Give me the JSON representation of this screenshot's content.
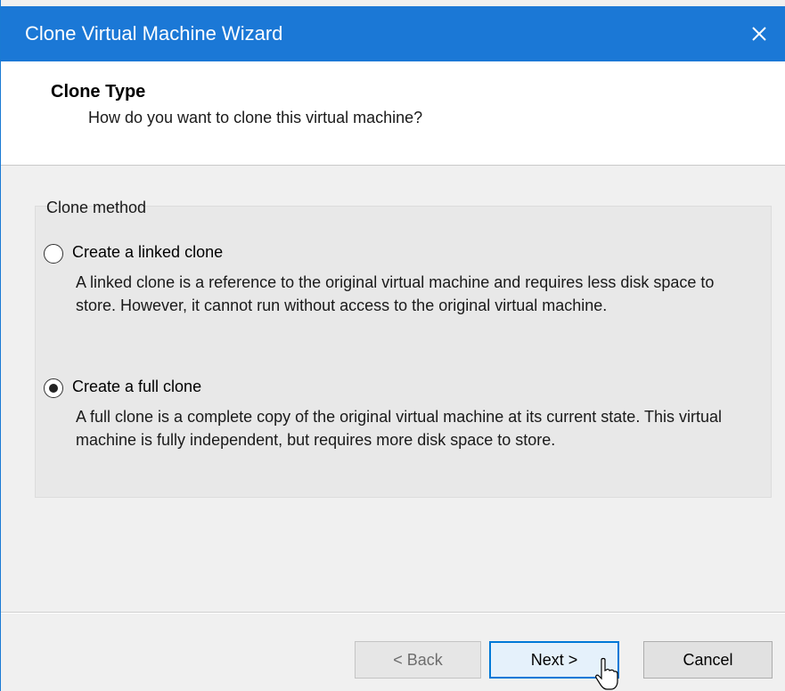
{
  "window": {
    "title": "Clone Virtual Machine Wizard",
    "accent_color": "#1b78d6",
    "close_icon": "close-icon"
  },
  "header": {
    "title": "Clone Type",
    "subtitle": "How do you want to clone this virtual machine?"
  },
  "clone_method": {
    "legend": "Clone method",
    "options": [
      {
        "label": "Create a linked clone",
        "selected": false,
        "description": "A linked clone is a reference to the original virtual machine and requires less disk space to store. However, it cannot run without access to the original virtual machine."
      },
      {
        "label": "Create a full clone",
        "selected": true,
        "description": "A full clone is a complete copy of the original virtual machine at its current state. This virtual machine is fully independent, but requires more disk space to store."
      }
    ]
  },
  "buttons": {
    "back": "< Back",
    "next": "Next >",
    "cancel": "Cancel"
  }
}
